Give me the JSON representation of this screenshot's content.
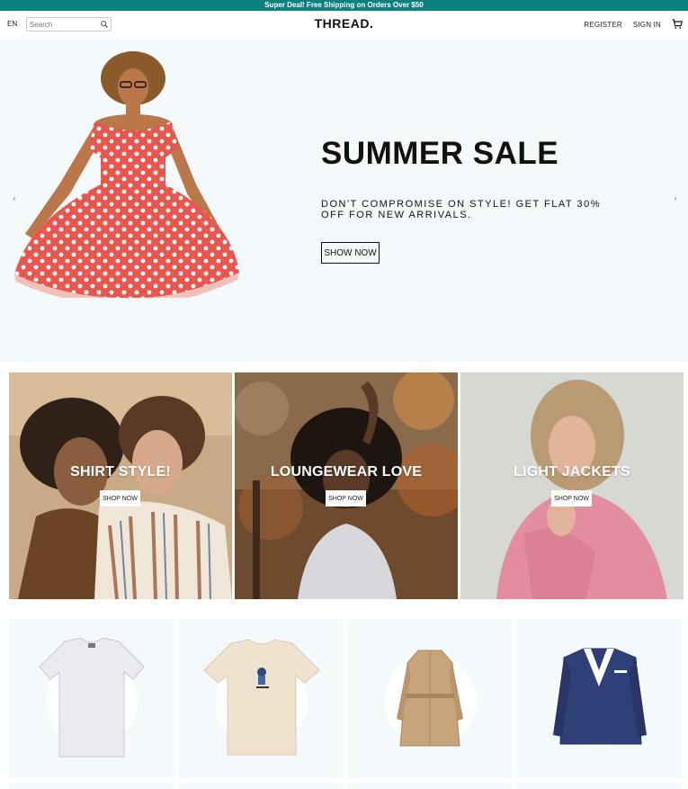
{
  "announcement": "Super Deal! Free Shipping on Orders Over $50",
  "nav": {
    "lang": "EN",
    "search_placeholder": "Search",
    "logo": "THREAD.",
    "register": "REGISTER",
    "signin": "SIGN IN",
    "icons": [
      "search-icon",
      "cart-icon"
    ]
  },
  "hero": {
    "title": "SUMMER SALE",
    "description": "DON'T COMPROMISE ON STYLE! GET FLAT 30% OFF FOR NEW ARRIVALS.",
    "button": "SHOW NOW",
    "left_arrow": "‹",
    "right_arrow": "›",
    "background": "#f4f9fb"
  },
  "categories": [
    {
      "title": "SHIRT STYLE!",
      "button": "SHOP NOW"
    },
    {
      "title": "LOUNGEWEAR LOVE",
      "button": "SHOP NOW"
    },
    {
      "title": "LIGHT JACKETS",
      "button": "SHOP NOW"
    }
  ],
  "products": [
    {
      "icon": "white-tshirt-icon"
    },
    {
      "icon": "cream-tshirt-icon"
    },
    {
      "icon": "trench-coat-icon"
    },
    {
      "icon": "navy-blazer-icon"
    }
  ],
  "colors": {
    "announcement_bg": "#0d8080",
    "text": "#111111",
    "panel_bg": "#f4f9fb"
  }
}
